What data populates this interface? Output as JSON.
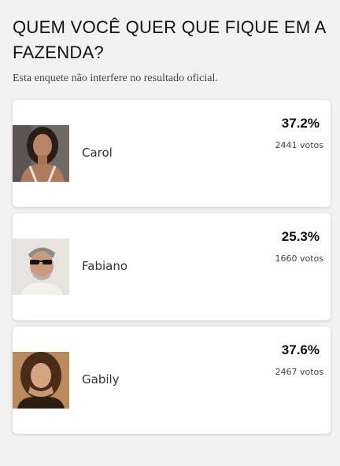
{
  "poll": {
    "title": "QUEM VOCÊ QUER QUE FIQUE EM A FAZENDA?",
    "disclaimer": "Esta enquete não interfere no resultado oficial.",
    "options": [
      {
        "name": "Carol",
        "percent": "37.2%",
        "votes": "2441 votos",
        "photo": "carol-photo"
      },
      {
        "name": "Fabiano",
        "percent": "25.3%",
        "votes": "1660 votos",
        "photo": "fabiano-photo"
      },
      {
        "name": "Gabily",
        "percent": "37.6%",
        "votes": "2467 votos",
        "photo": "gabily-photo"
      }
    ]
  }
}
